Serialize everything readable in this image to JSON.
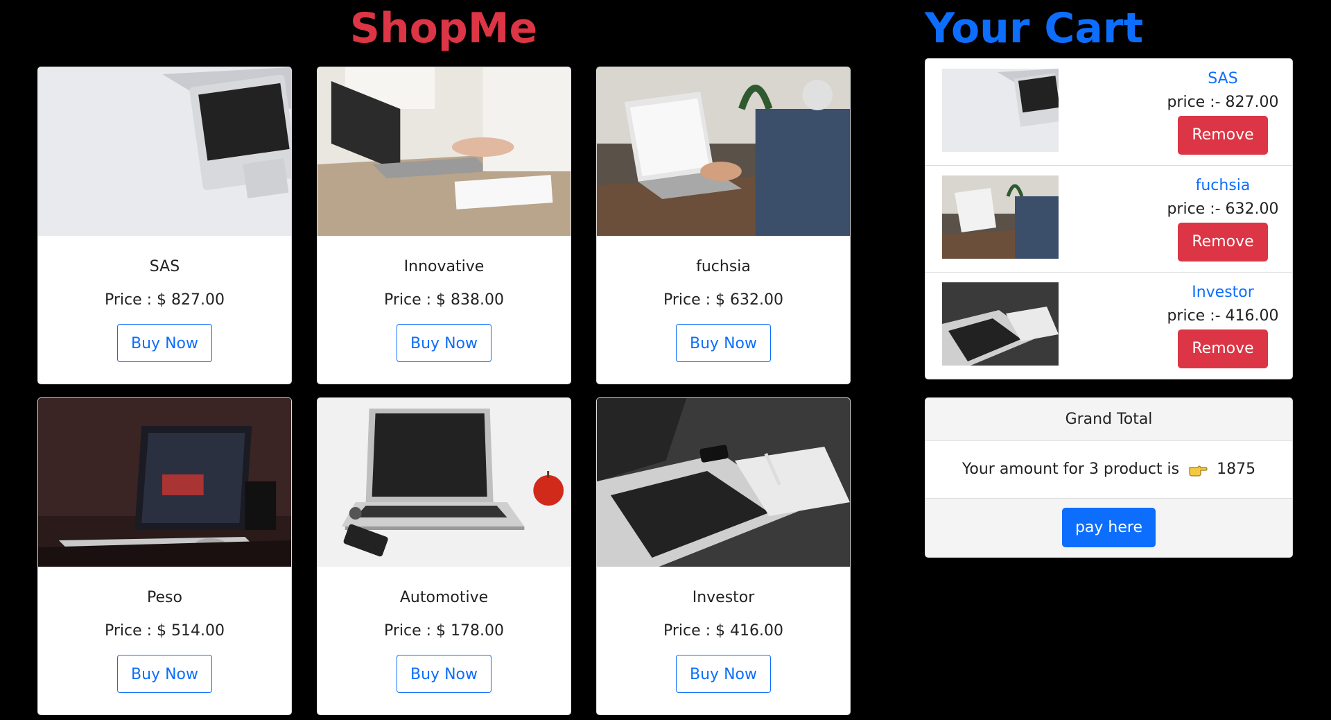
{
  "header": {
    "shop_title": "ShopMe",
    "cart_title": "Your Cart"
  },
  "products": [
    {
      "name": "SAS",
      "price": "Price : $ 827.00",
      "button": "Buy Now",
      "image": "laptop-corner-photo"
    },
    {
      "name": "Innovative",
      "price": "Price : $ 838.00",
      "button": "Buy Now",
      "image": "woman-typing-laptop-photo"
    },
    {
      "name": "fuchsia",
      "price": "Price : $ 632.00",
      "button": "Buy Now",
      "image": "man-typing-laptop-photo"
    },
    {
      "name": "Peso",
      "price": "Price : $ 514.00",
      "button": "Buy Now",
      "image": "dark-laptop-desk-photo"
    },
    {
      "name": "Automotive",
      "price": "Price : $ 178.00",
      "button": "Buy Now",
      "image": "macbook-apple-photo"
    },
    {
      "name": "Investor",
      "price": "Price : $ 416.00",
      "button": "Buy Now",
      "image": "laptop-notebook-dark-photo"
    }
  ],
  "cart": {
    "items": [
      {
        "name": "SAS",
        "price": "price :- 827.00",
        "button": "Remove",
        "image": "laptop-corner-photo"
      },
      {
        "name": "fuchsia",
        "price": "price :- 632.00",
        "button": "Remove",
        "image": "man-typing-laptop-photo"
      },
      {
        "name": "Investor",
        "price": "price :- 416.00",
        "button": "Remove",
        "image": "laptop-notebook-dark-photo"
      }
    ]
  },
  "total": {
    "header": "Grand Total",
    "text": "Your amount for 3 product is",
    "amount": "1875",
    "icon": "pointing-hand-icon",
    "pay_button": "pay here"
  },
  "colors": {
    "background": "#000000",
    "shop_title": "#dc3545",
    "cart_title": "#0d6efd",
    "remove": "#dc3545",
    "pay": "#0d6efd"
  }
}
